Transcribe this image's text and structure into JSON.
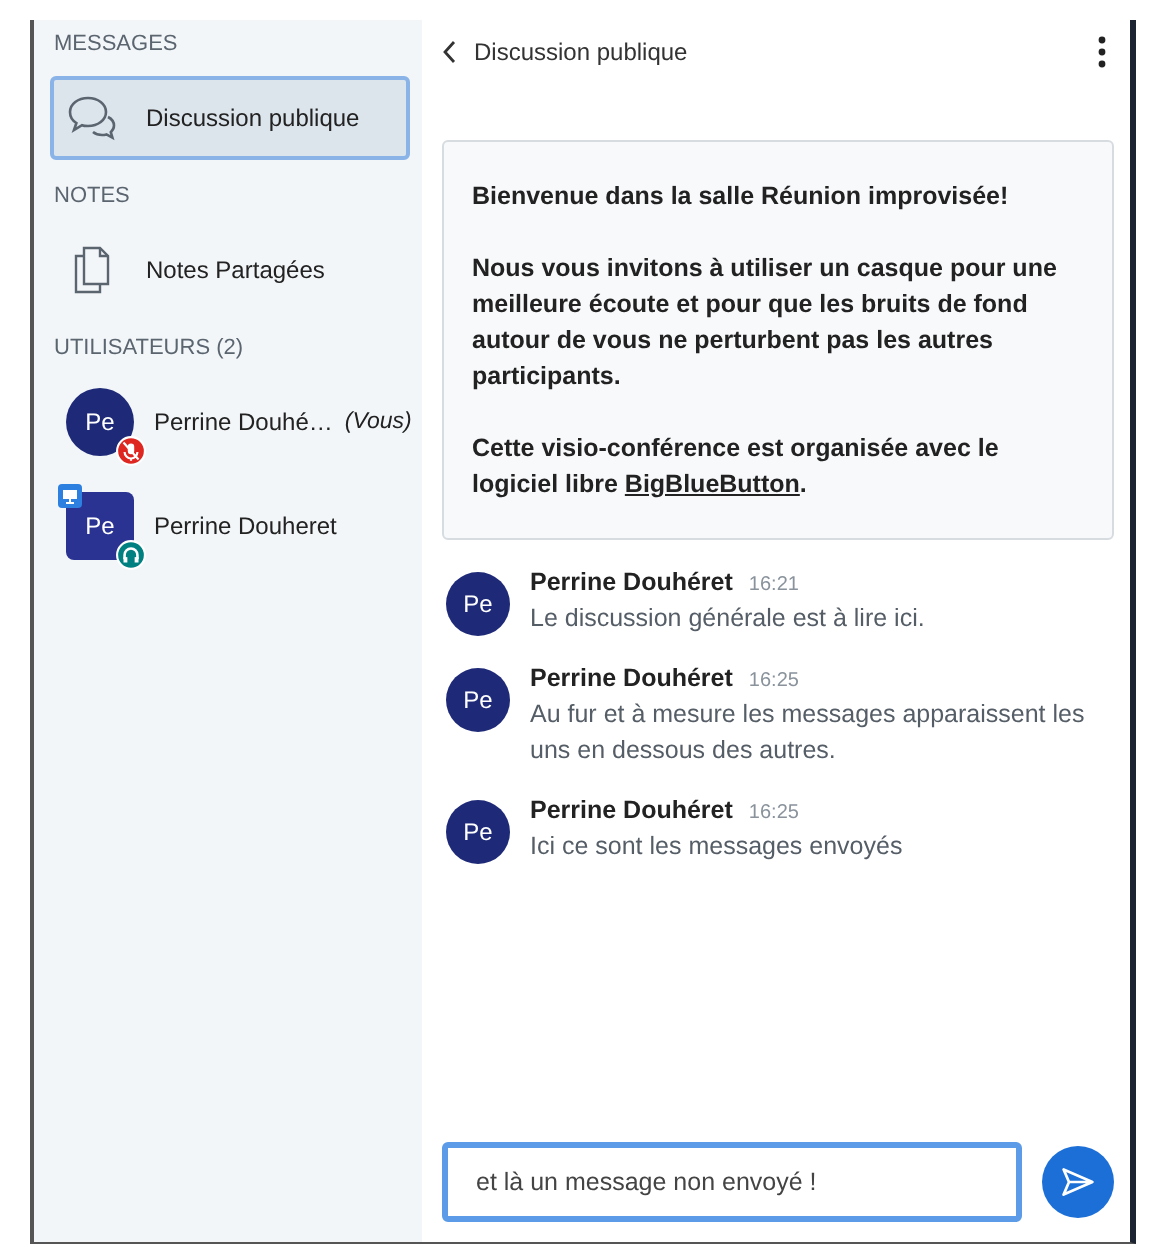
{
  "sidebar": {
    "sections": [
      {
        "title": "MESSAGES",
        "items": [
          {
            "label": "Discussion publique",
            "kind": "chat",
            "selected": true
          }
        ]
      },
      {
        "title": "NOTES",
        "items": [
          {
            "label": "Notes Partagées",
            "kind": "notes",
            "selected": false
          }
        ]
      }
    ],
    "users_title": "UTILISATEURS (2)",
    "users": [
      {
        "initials": "Pe",
        "name": "Perrine Douhé…",
        "you_label": "(Vous)",
        "presenter": false,
        "muted": true
      },
      {
        "initials": "Pe",
        "name": "Perrine Douheret",
        "presenter": true,
        "muted": false
      }
    ]
  },
  "chat": {
    "title": "Discussion publique",
    "welcome": {
      "heading": "Bienvenue dans la salle **Réunion improvisée**!",
      "body": "Nous vous invitons à utiliser un casque pour une meilleure écoute et pour que les bruits de fond autour de vous ne perturbent pas les autres participants.",
      "footer": "Cette visio-conférence est organisée avec le logiciel libre ",
      "link": "BigBlueButton",
      "footer_end": "."
    },
    "messages": [
      {
        "initials": "Pe",
        "author": "Perrine Douhéret",
        "time": "16:21",
        "text": "Le discussion générale est à lire ici."
      },
      {
        "initials": "Pe",
        "author": "Perrine Douhéret",
        "time": "16:25",
        "text": "Au fur et à mesure les messages apparaissent les uns en dessous des autres."
      },
      {
        "initials": "Pe",
        "author": "Perrine Douhéret",
        "time": "16:25",
        "text": "Ici ce sont les messages envoyés"
      }
    ],
    "input": {
      "value": "et là un message non envoyé !"
    }
  }
}
